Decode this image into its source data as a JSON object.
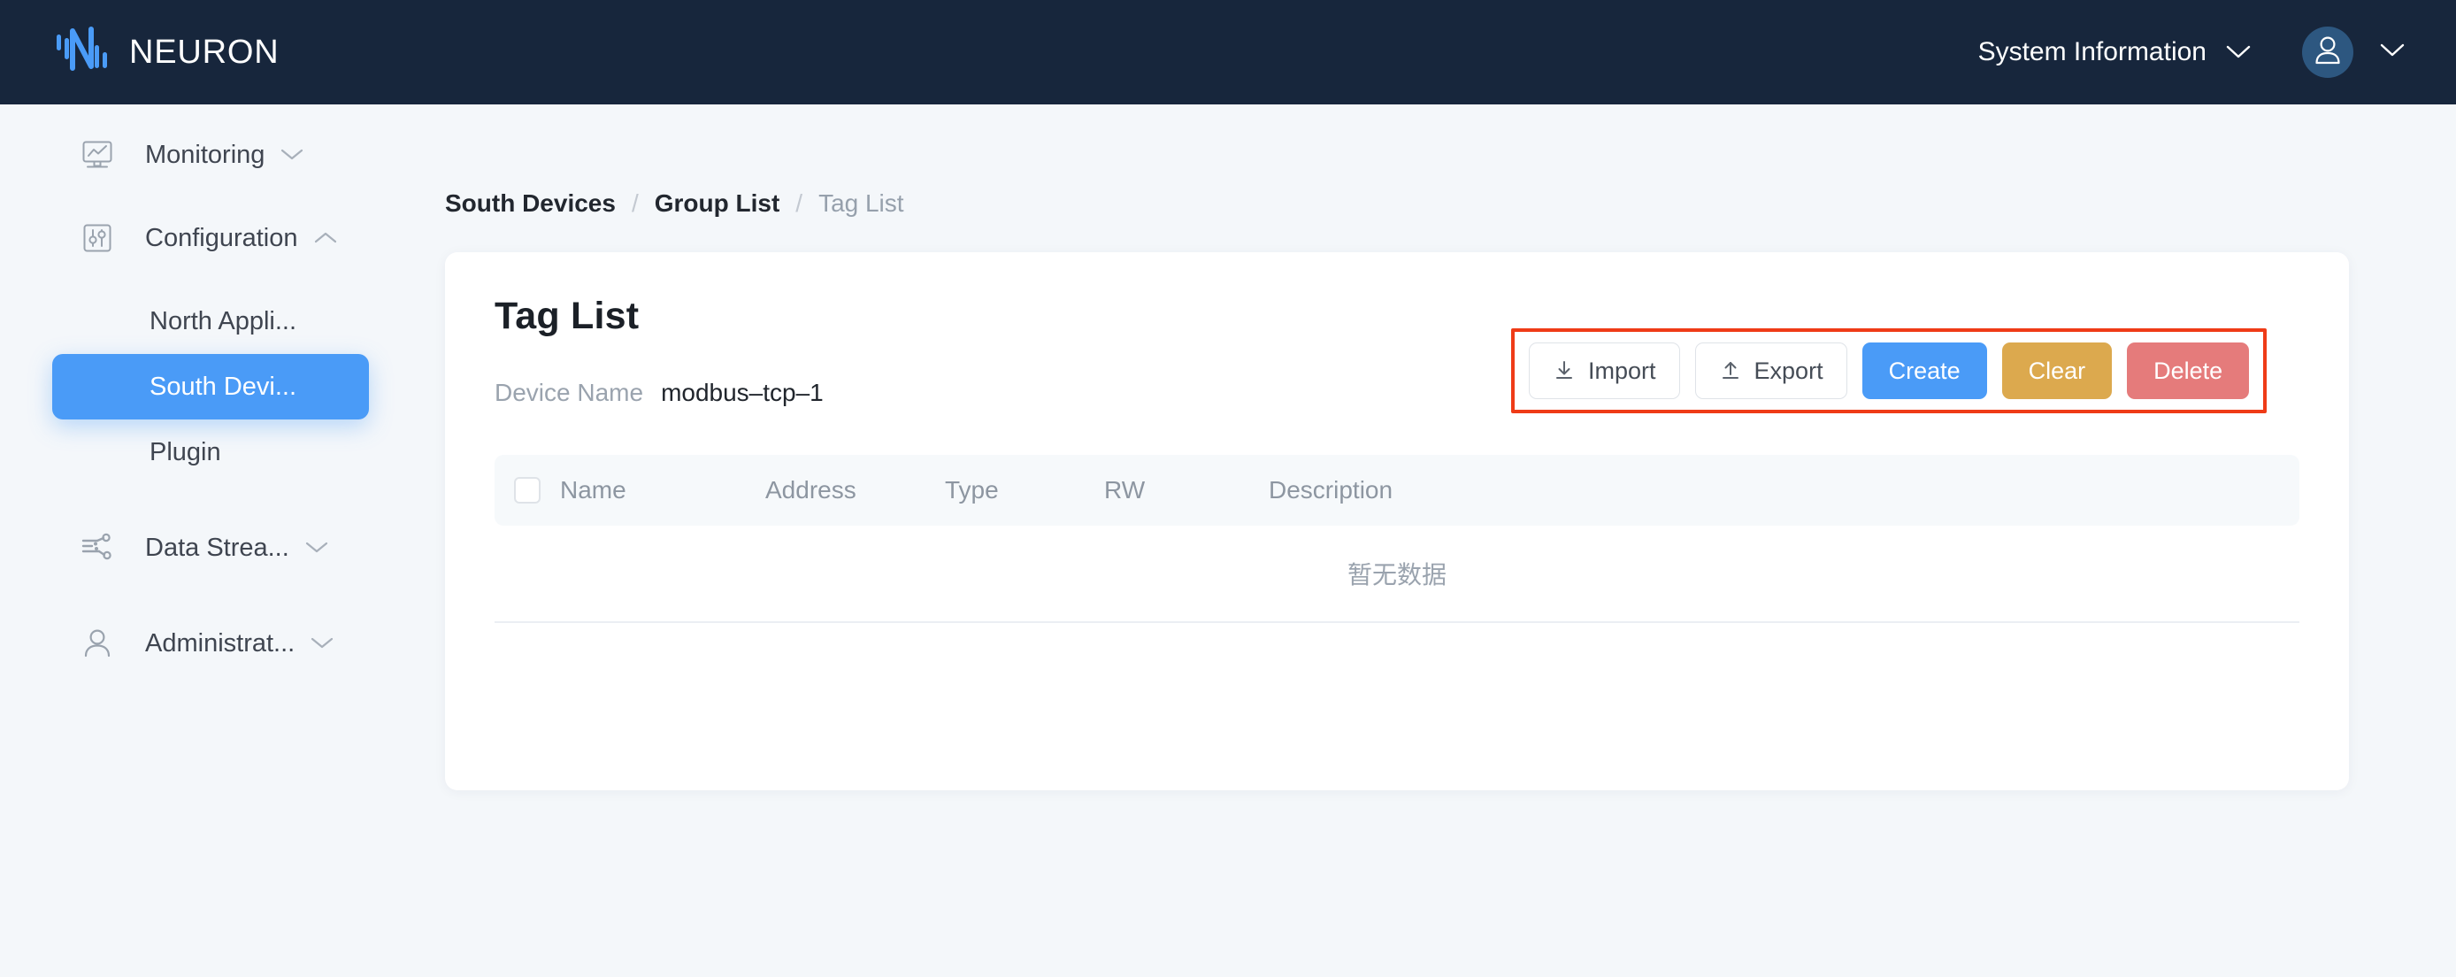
{
  "header": {
    "brand": "NEURON",
    "logo_icon": "neuron-logo-icon",
    "system_info_label": "System Information",
    "system_info_caret_icon": "chevron-down-icon",
    "avatar_icon": "user-avatar-icon",
    "avatar_caret_icon": "chevron-down-icon",
    "bg_color": "#17263c"
  },
  "sidebar": {
    "items": [
      {
        "label": "Monitoring",
        "icon": "monitor-chart-icon",
        "caret": "chevron-down-icon",
        "expanded": false
      },
      {
        "label": "Configuration",
        "icon": "sliders-icon",
        "caret": "chevron-up-icon",
        "expanded": true
      },
      {
        "label": "Data Strea...",
        "icon": "data-stream-icon",
        "caret": "chevron-down-icon",
        "expanded": false
      },
      {
        "label": "Administrat...",
        "icon": "user-icon",
        "caret": "chevron-down-icon",
        "expanded": false
      }
    ],
    "config_children": [
      {
        "label": "North Appli...",
        "active": false
      },
      {
        "label": "South Devi...",
        "active": true
      },
      {
        "label": "Plugin",
        "active": false
      }
    ],
    "active_color": "#4a9bf7"
  },
  "breadcrumb": {
    "items": [
      {
        "label": "South Devices",
        "current": false
      },
      {
        "label": "Group List",
        "current": false
      },
      {
        "label": "Tag List",
        "current": true
      }
    ],
    "separator": "/"
  },
  "card": {
    "title": "Tag List",
    "device_name_label": "Device Name",
    "device_name_value": "modbus–tcp–1"
  },
  "toolbar": {
    "highlight_color": "#ef3b17",
    "buttons": [
      {
        "label": "Import",
        "style": "ghost",
        "icon": "download-icon"
      },
      {
        "label": "Export",
        "style": "ghost",
        "icon": "upload-icon"
      },
      {
        "label": "Create",
        "style": "primary",
        "color": "#4a9bf7"
      },
      {
        "label": "Clear",
        "style": "warn",
        "color": "#dca94e"
      },
      {
        "label": "Delete",
        "style": "danger",
        "color": "#e57b7b"
      }
    ]
  },
  "table": {
    "select_all_checked": false,
    "columns": [
      "Name",
      "Address",
      "Type",
      "RW",
      "Description"
    ],
    "rows": [],
    "empty_text": "暂无数据"
  }
}
